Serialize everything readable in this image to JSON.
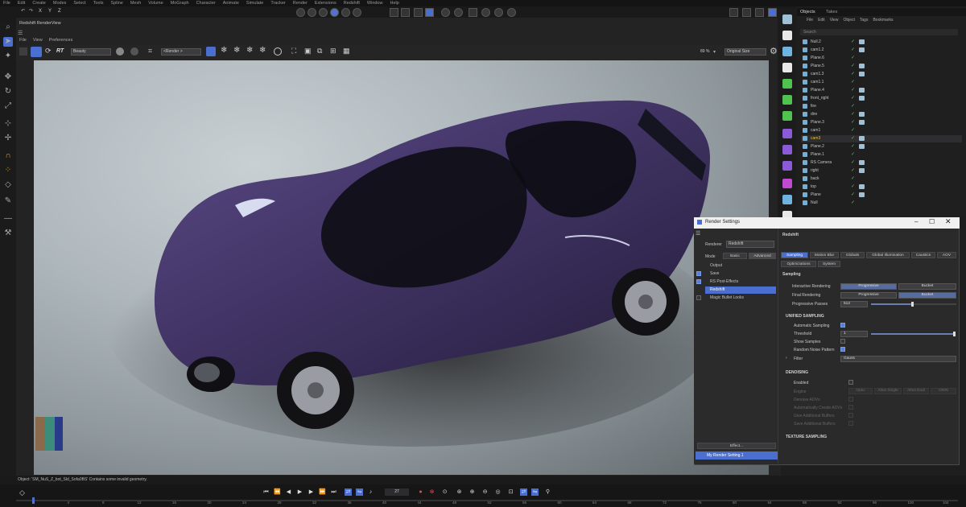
{
  "menubar": [
    "File",
    "Edit",
    "Create",
    "Modes",
    "Select",
    "Tools",
    "Spline",
    "Mesh",
    "Volume",
    "MoGraph",
    "Character",
    "Animate",
    "Simulate",
    "Tracker",
    "Render",
    "Extensions",
    "Redshift",
    "Window",
    "Help"
  ],
  "toolbar": {
    "axes": [
      "X",
      "Y",
      "Z"
    ]
  },
  "render_view": {
    "title": "Redshift RenderView",
    "menu": [
      "File",
      "View",
      "Preferences"
    ],
    "rt_label": "RT",
    "aov_value": "Beauty",
    "camera_value": "<Render >",
    "zoom": "89 %",
    "size_value": "Original Size"
  },
  "objects_panel": {
    "tabs": [
      "Objects",
      "Takes"
    ],
    "menu": [
      "File",
      "Edit",
      "View",
      "Object",
      "Tags",
      "Bookmarks"
    ],
    "search_placeholder": "Search",
    "items": [
      "Null.2",
      "cam1.2",
      "Plane.6",
      "Plane.5",
      "cam1.3",
      "cam1.1",
      "Plane.4",
      "front_right",
      "fire",
      "dire",
      "Plane.3",
      "cam1",
      "cam3",
      "Plane.2",
      "Plane.1",
      "RS Camera",
      "right",
      "back",
      "top",
      "Plane",
      "Null"
    ]
  },
  "render_settings": {
    "title": "Render Settings",
    "renderer_label": "Renderer",
    "renderer_value": "Redshift",
    "mode_label": "Mode",
    "mode_options": [
      "Basic",
      "Advanced"
    ],
    "left_items": [
      "Output",
      "Save",
      "RS Post-Effects",
      "Redshift",
      "Magic Bullet Looks"
    ],
    "effect_button": "Effect...",
    "setting_name": "My Render Setting.1",
    "section_title": "Redshift",
    "tabs_row1": [
      "Sampling",
      "Motion Blur",
      "Globals",
      "Global Illumination",
      "Caustics",
      "AOV"
    ],
    "tabs_row2": [
      "Optimizations",
      "System"
    ],
    "sampling_header": "Sampling",
    "interactive_label": "Interactive Rendering",
    "final_label": "Final Rendering",
    "progressive": "Progressive",
    "bucket": "Bucket",
    "passes_label": "Progressive Passes",
    "passes_value": "512",
    "unified_header": "UNIFIED SAMPLING",
    "auto_sampling": "Automatic Sampling",
    "threshold_label": "Threshold",
    "threshold_value": "1",
    "show_samples": "Show Samples",
    "random_noise": "Random Noise Pattern",
    "filter_label": "Filter",
    "filter_value": "Gauss",
    "denoising_header": "DENOISING",
    "enabled_label": "Enabled",
    "engine_label": "Engine",
    "engine_options": [
      "Optix",
      "Altus Single",
      "Altus Dual",
      "OIDN"
    ],
    "denoise_aovs": "Denoise AOVs",
    "auto_create_aovs": "Automatically Create AOVs",
    "extra_buffers": "Give Additional Buffers",
    "save_buffers": "Save Additional Buffers",
    "texture_header": "TEXTURE SAMPLING"
  },
  "status_text": "Object: 'SM_NuS_Z_bot_Sld_Sofa0BS' Contains some invalid geometry.",
  "timeline": {
    "current_frame": "27",
    "ticks": [
      "0",
      "4",
      "8",
      "12",
      "16",
      "20",
      "24",
      "28",
      "32",
      "36",
      "40",
      "44",
      "48",
      "52",
      "56",
      "60",
      "64",
      "68",
      "72",
      "76",
      "80",
      "84",
      "88",
      "92",
      "96",
      "100",
      "104"
    ]
  },
  "colors": {
    "accent": "#4a6fd0",
    "check_green": "#4fc24f",
    "car_body": "#4b3c6c"
  }
}
